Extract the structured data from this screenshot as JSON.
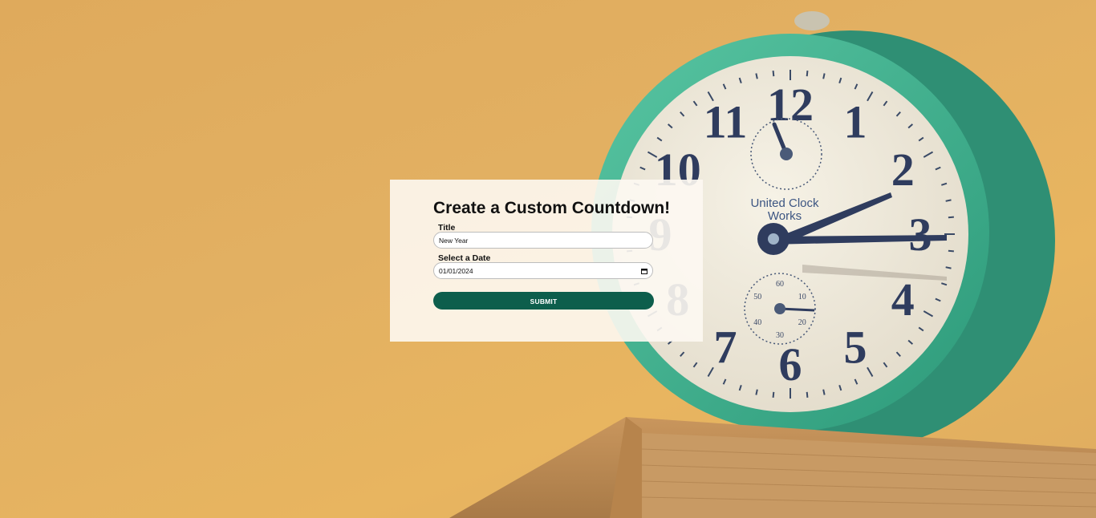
{
  "form": {
    "title": "Create a Custom Countdown!",
    "title_label": "Title",
    "title_value": "New Year",
    "date_label": "Select a Date",
    "date_value": "01/01/2024",
    "submit_label": "SUBMIT"
  },
  "background": {
    "clock_brand_line1": "United Clock",
    "clock_brand_line2": "Works",
    "dial_numbers": [
      "12",
      "1",
      "2",
      "3",
      "4",
      "5",
      "6",
      "7",
      "8",
      "9",
      "10",
      "11"
    ],
    "small_dial_numbers": [
      "60",
      "10",
      "20",
      "30",
      "40",
      "50"
    ]
  },
  "colors": {
    "background": "#e2b062",
    "card": "#fdf8f2",
    "submit": "#0d5e4c",
    "clock_case": "#3fae8c"
  }
}
